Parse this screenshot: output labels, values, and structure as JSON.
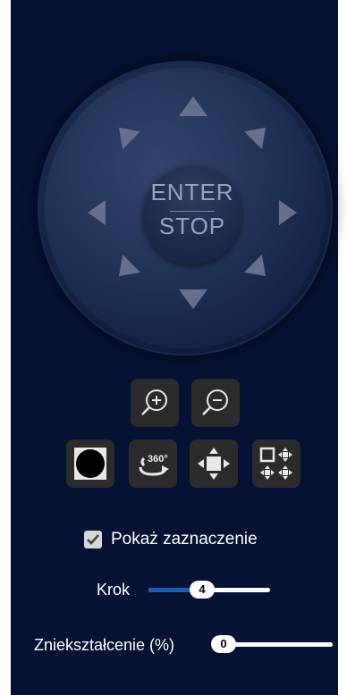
{
  "ptz": {
    "enter_label": "ENTER",
    "stop_label": "STOP"
  },
  "buttons": {
    "zoom_in": "zoom-in-icon",
    "zoom_out": "zoom-out-icon",
    "record": "circle-icon",
    "rotate_360": "rotate-360-icon",
    "center": "center-move-icon",
    "multi_direction": "multi-direction-icon",
    "rotate_360_text": "360°"
  },
  "options": {
    "show_selection_label": "Pokaż zaznaczenie",
    "show_selection_checked": true
  },
  "step": {
    "label": "Krok",
    "value": "4"
  },
  "distortion": {
    "label": "Zniekształcenie (%)",
    "value": "0"
  },
  "colors": {
    "background": "#061234",
    "button_bg": "#2b2b2b",
    "slider_fill": "#1e5cb3",
    "arrow": "#66708e"
  }
}
